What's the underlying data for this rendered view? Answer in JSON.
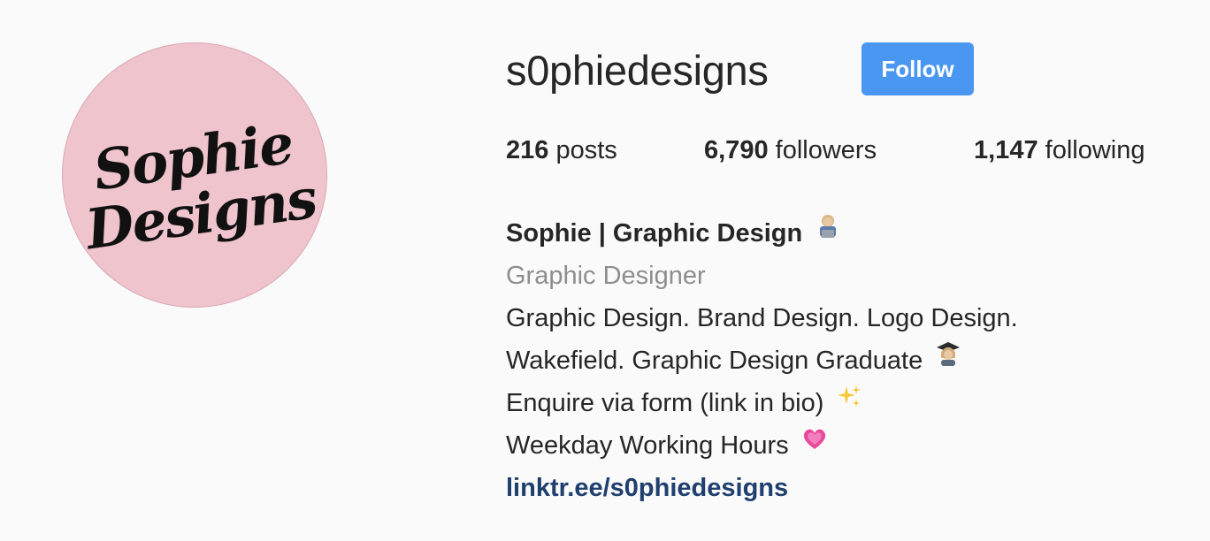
{
  "profile": {
    "username": "s0phiedesigns",
    "follow_label": "Follow",
    "avatar_logo_text": [
      "Sophie",
      "Designs"
    ]
  },
  "stats": {
    "posts_count": "216",
    "posts_label": "posts",
    "followers_count": "6,790",
    "followers_label": "followers",
    "following_count": "1,147",
    "following_label": "following"
  },
  "bio": {
    "name": "Sophie | Graphic Design",
    "category": "Graphic Designer",
    "lines": [
      "Graphic Design. Brand Design. Logo Design.",
      "Wakefield. Graphic Design Graduate",
      "Enquire via form (link in bio)",
      "Weekday Working Hours"
    ],
    "link": "linktr.ee/s0phiedesigns"
  },
  "icons": {
    "name_emoji": "technologist-woman-icon",
    "graduate_emoji": "graduate-woman-icon",
    "sparkles_emoji": "sparkles-icon",
    "heart_emoji": "growing-heart-icon"
  },
  "colors": {
    "background": "#fafafa",
    "follow_button": "#4a97f2",
    "link": "#1f3f6e",
    "category": "#8e8e8e",
    "avatar_bg": "#efc4cd"
  }
}
